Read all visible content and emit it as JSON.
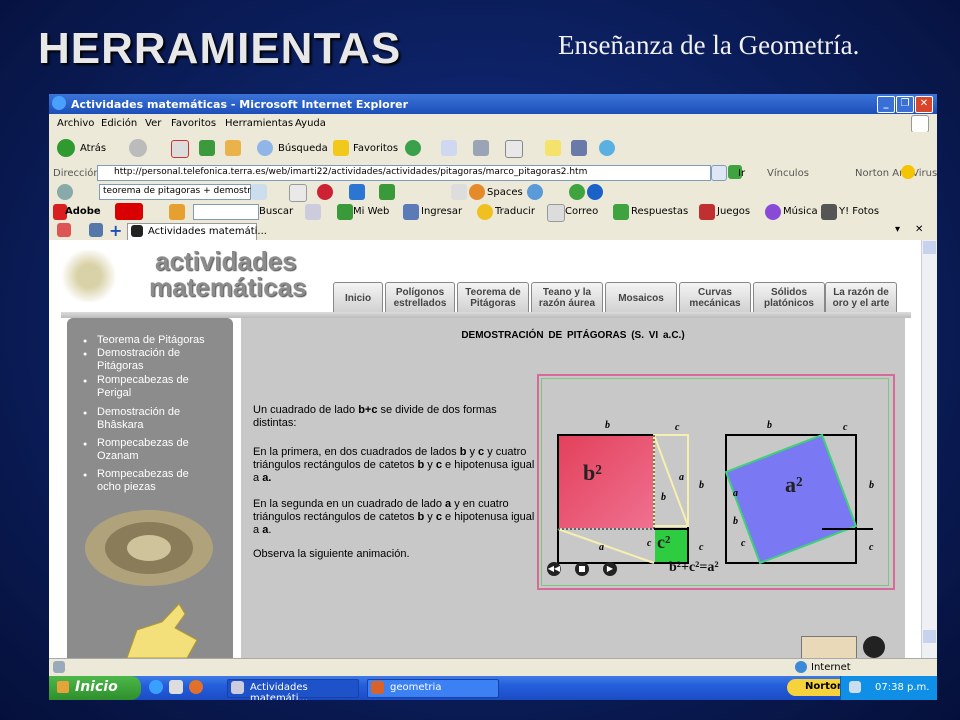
{
  "slide": {
    "title": "HERRAMIENTAS",
    "subtitle": "Enseñanza de la Geometría."
  },
  "window": {
    "title": "Actividades matemáticas - Microsoft Internet Explorer"
  },
  "menu": [
    "Archivo",
    "Edición",
    "Ver",
    "Favoritos",
    "Herramientas",
    "Ayuda"
  ],
  "toolbar": {
    "back": "Atrás",
    "search": "Búsqueda",
    "favorites": "Favoritos"
  },
  "address": {
    "label": "Dirección",
    "url": "http://personal.telefonica.terra.es/web/imarti22/actividades/actividades/pitagoras/marco_pitagoras2.htm",
    "go": "Ir",
    "links": "Vínculos",
    "antivirus": "Norton AntiVirus"
  },
  "searchbar": {
    "query": "teorema de pitagoras + demostra",
    "spaces": "Spaces"
  },
  "yahoo": {
    "adobe": "Adobe",
    "search_btn": "Buscar",
    "myweb": "Mi Web",
    "signin": "Ingresar",
    "translate": "Traducir",
    "mail": "Correo",
    "answers": "Respuestas",
    "games": "Juegos",
    "music": "Música",
    "photos": "Y! Fotos"
  },
  "tab": {
    "label": "Actividades matemáti..."
  },
  "site": {
    "logo_line1": "actividades",
    "logo_line2": "matemáticas",
    "nav": [
      "Inicio",
      "Polígonos estrellados",
      "Teorema de Pitágoras",
      "Teano y la razón áurea",
      "Mosaicos",
      "Curvas mecánicas",
      "Sólidos platónicos",
      "La razón de oro y el arte"
    ],
    "sidebar": [
      "Teorema de Pitágoras",
      "Demostración de Pitágoras",
      "Rompecabezas de Perigal",
      "Demostración de Bhâskara",
      "Rompecabezas de Ozanam",
      "Rompecabezas de ocho piezas"
    ],
    "heading": "DEMOSTRACIÓN DE PITÁGORAS (S. VI a.C.)",
    "p1a": "Un cuadrado de lado ",
    "p1b": "b+c",
    "p1c": " se divide de dos formas distintas:",
    "p2a": "En la primera, en dos cuadrados de lados ",
    "p2b": "b",
    "p2c": " y ",
    "p2d": "c",
    "p2e": " y cuatro triángulos rectángulos de catetos ",
    "p2f": "b",
    "p2g": " y ",
    "p2h": "c",
    "p2i": " e hipotenusa igual a ",
    "p2j": "a.",
    "p3a": "En la segunda en un cuadrado de lado ",
    "p3b": "a",
    "p3c": " y en cuatro triángulos rectángulos de catetos ",
    "p3d": "b",
    "p3e": " y ",
    "p3f": "c",
    "p3g": " e hipotenusa igual a ",
    "p3h": "a",
    "p3i": ".",
    "p4": "Observa la siguiente animación.",
    "formula": "b²+c²=a²",
    "b2": "b²",
    "c2": "c²",
    "a2": "a²",
    "lb": "b",
    "lc": "c",
    "la": "a"
  },
  "status": {
    "zone": "Internet"
  },
  "taskbar": {
    "start": "Inicio",
    "task1": "Actividades matemáti...",
    "task2": "geometria",
    "norton": "Norton",
    "time": "07:38 p.m."
  },
  "colors": {
    "accent": "#245edb",
    "site_gray": "#8c8c8c",
    "b2": "#e0405a",
    "c2": "#2ecc40",
    "a2": "#6a66f0"
  }
}
